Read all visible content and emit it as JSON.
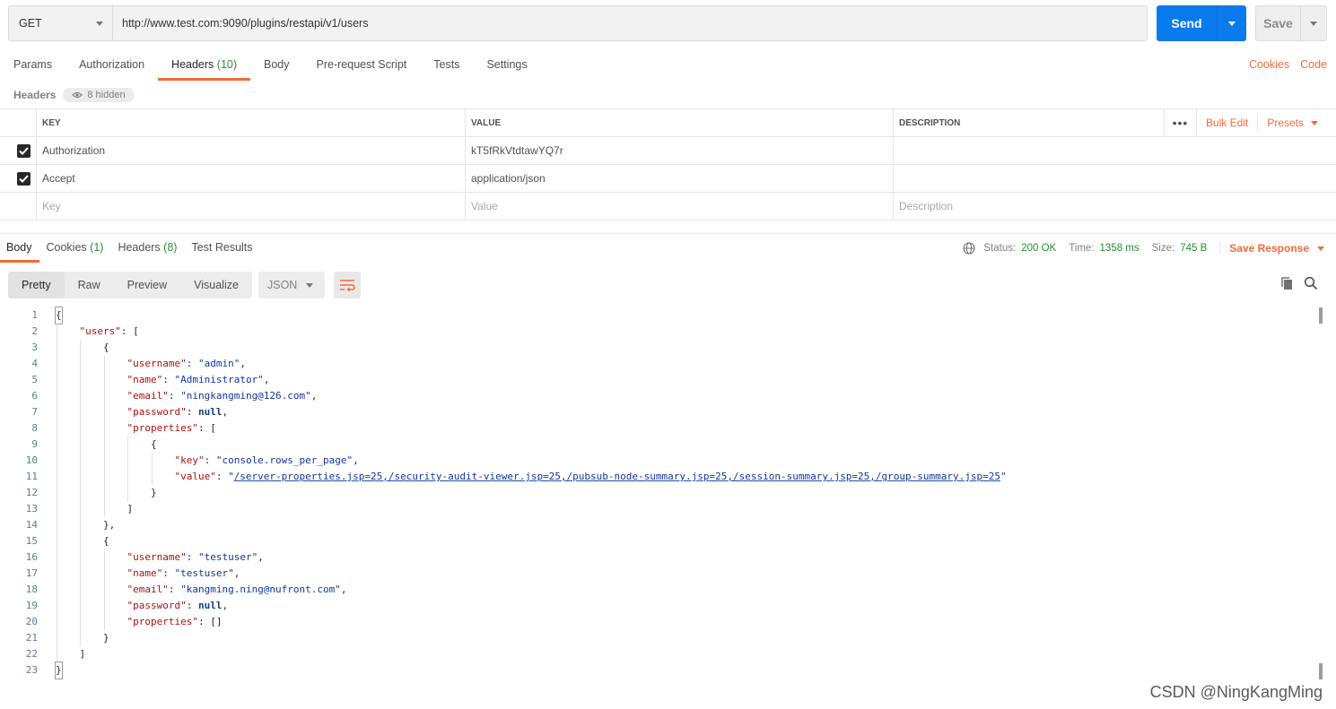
{
  "request": {
    "method": "GET",
    "url": "http://www.test.com:9090/plugins/restapi/v1/users",
    "send_label": "Send",
    "save_label": "Save"
  },
  "request_tabs": [
    {
      "label": "Params",
      "count": ""
    },
    {
      "label": "Authorization",
      "count": ""
    },
    {
      "label": "Headers",
      "count": "(10)"
    },
    {
      "label": "Body",
      "count": ""
    },
    {
      "label": "Pre-request Script",
      "count": ""
    },
    {
      "label": "Tests",
      "count": ""
    },
    {
      "label": "Settings",
      "count": ""
    }
  ],
  "request_links": {
    "cookies": "Cookies",
    "code": "Code"
  },
  "headers_section": {
    "title": "Headers",
    "hidden": "8 hidden"
  },
  "headers_table": {
    "columns": {
      "key": "KEY",
      "value": "VALUE",
      "description": "DESCRIPTION"
    },
    "actions": {
      "more": "•••",
      "bulk_edit": "Bulk Edit",
      "presets": "Presets"
    },
    "rows": [
      {
        "key": "Authorization",
        "value": "kT5fRkVtdtawYQ7r",
        "description": ""
      },
      {
        "key": "Accept",
        "value": "application/json",
        "description": ""
      }
    ],
    "placeholders": {
      "key": "Key",
      "value": "Value",
      "description": "Description"
    }
  },
  "response_tabs": [
    {
      "label": "Body",
      "count": ""
    },
    {
      "label": "Cookies",
      "count": "(1)"
    },
    {
      "label": "Headers",
      "count": "(8)"
    },
    {
      "label": "Test Results",
      "count": ""
    }
  ],
  "response_meta": {
    "status_label": "Status:",
    "status": "200 OK",
    "time_label": "Time:",
    "time": "1358 ms",
    "size_label": "Size:",
    "size": "745 B",
    "save_response": "Save Response"
  },
  "view_options": [
    "Pretty",
    "Raw",
    "Preview",
    "Visualize"
  ],
  "format": "JSON",
  "code_lines": [
    [
      {
        "t": "{",
        "c": "brk"
      }
    ],
    [
      {
        "t": "    "
      },
      {
        "t": "\"users\"",
        "c": "k"
      },
      {
        "t": ": ["
      }
    ],
    [
      {
        "t": "        {"
      }
    ],
    [
      {
        "t": "            "
      },
      {
        "t": "\"username\"",
        "c": "k"
      },
      {
        "t": ": "
      },
      {
        "t": "\"admin\"",
        "c": "s"
      },
      {
        "t": ","
      }
    ],
    [
      {
        "t": "            "
      },
      {
        "t": "\"name\"",
        "c": "k"
      },
      {
        "t": ": "
      },
      {
        "t": "\"Administrator\"",
        "c": "s"
      },
      {
        "t": ","
      }
    ],
    [
      {
        "t": "            "
      },
      {
        "t": "\"email\"",
        "c": "k"
      },
      {
        "t": ": "
      },
      {
        "t": "\"ningkangming@126.com\"",
        "c": "s"
      },
      {
        "t": ","
      }
    ],
    [
      {
        "t": "            "
      },
      {
        "t": "\"password\"",
        "c": "k"
      },
      {
        "t": ": "
      },
      {
        "t": "null",
        "c": "kw"
      },
      {
        "t": ","
      }
    ],
    [
      {
        "t": "            "
      },
      {
        "t": "\"properties\"",
        "c": "k"
      },
      {
        "t": ": ["
      }
    ],
    [
      {
        "t": "                {"
      }
    ],
    [
      {
        "t": "                    "
      },
      {
        "t": "\"key\"",
        "c": "k"
      },
      {
        "t": ": "
      },
      {
        "t": "\"console.rows_per_page\"",
        "c": "s"
      },
      {
        "t": ","
      }
    ],
    [
      {
        "t": "                    "
      },
      {
        "t": "\"value\"",
        "c": "k"
      },
      {
        "t": ": "
      },
      {
        "t": "\"",
        "c": "s"
      },
      {
        "t": "/server-properties.jsp=25,/security-audit-viewer.jsp=25,/pubsub-node-summary.jsp=25,/session-summary.jsp=25,/group-summary.jsp=25",
        "c": "link"
      },
      {
        "t": "\"",
        "c": "s"
      }
    ],
    [
      {
        "t": "                }"
      }
    ],
    [
      {
        "t": "            ]"
      }
    ],
    [
      {
        "t": "        },"
      }
    ],
    [
      {
        "t": "        {"
      }
    ],
    [
      {
        "t": "            "
      },
      {
        "t": "\"username\"",
        "c": "k"
      },
      {
        "t": ": "
      },
      {
        "t": "\"testuser\"",
        "c": "s"
      },
      {
        "t": ","
      }
    ],
    [
      {
        "t": "            "
      },
      {
        "t": "\"name\"",
        "c": "k"
      },
      {
        "t": ": "
      },
      {
        "t": "\"testuser\"",
        "c": "s"
      },
      {
        "t": ","
      }
    ],
    [
      {
        "t": "            "
      },
      {
        "t": "\"email\"",
        "c": "k"
      },
      {
        "t": ": "
      },
      {
        "t": "\"kangming.ning@nufront.com\"",
        "c": "s"
      },
      {
        "t": ","
      }
    ],
    [
      {
        "t": "            "
      },
      {
        "t": "\"password\"",
        "c": "k"
      },
      {
        "t": ": "
      },
      {
        "t": "null",
        "c": "kw"
      },
      {
        "t": ","
      }
    ],
    [
      {
        "t": "            "
      },
      {
        "t": "\"properties\"",
        "c": "k"
      },
      {
        "t": ": []"
      }
    ],
    [
      {
        "t": "        }"
      }
    ],
    [
      {
        "t": "    ]"
      }
    ],
    [
      {
        "t": "}",
        "c": "brk"
      }
    ]
  ],
  "watermark": "CSDN @NingKangMing",
  "colors": {
    "accent": "#f26b3a",
    "send": "#097bed",
    "ok": "#2d8a34",
    "json_key": "#a11",
    "json_string": "#12369b"
  }
}
